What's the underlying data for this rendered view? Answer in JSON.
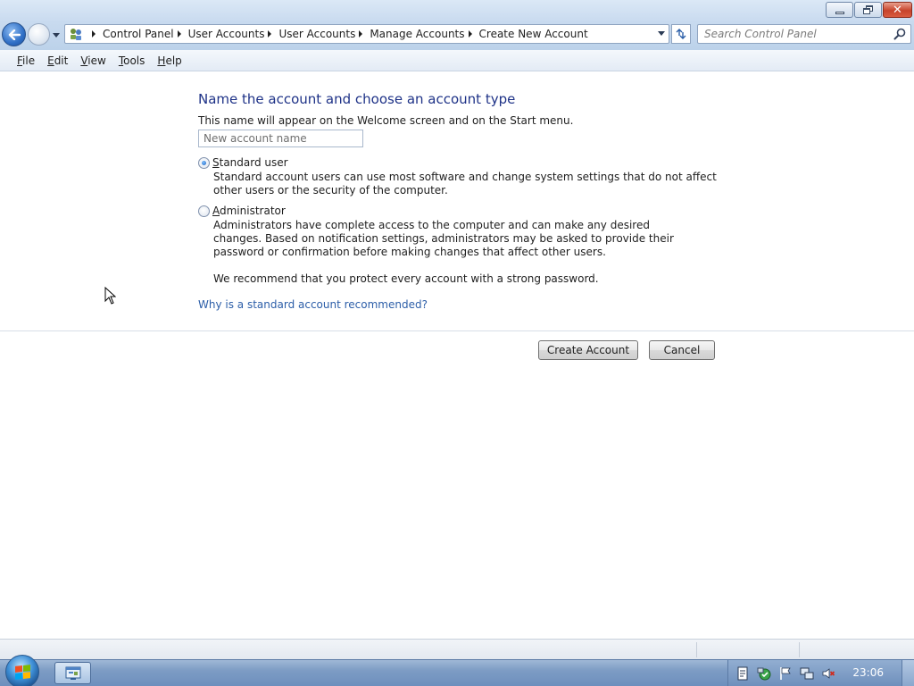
{
  "window": {
    "minimize_icon": "minimize-icon",
    "maximize_icon": "restore-icon",
    "close_icon": "close-icon"
  },
  "navigation": {
    "breadcrumbs": [
      "Control Panel",
      "User Accounts",
      "User Accounts",
      "Manage Accounts",
      "Create New Account"
    ],
    "search_placeholder": "Search Control Panel"
  },
  "menu": {
    "items": [
      {
        "underline": "F",
        "rest": "ile"
      },
      {
        "underline": "E",
        "rest": "dit"
      },
      {
        "underline": "V",
        "rest": "iew"
      },
      {
        "underline": "T",
        "rest": "ools"
      },
      {
        "underline": "H",
        "rest": "elp"
      }
    ]
  },
  "form": {
    "heading": "Name the account and choose an account type",
    "subtext": "This name will appear on the Welcome screen and on the Start menu.",
    "name_placeholder": "New account name",
    "standard_option": {
      "label_underline": "S",
      "label_rest": "tandard user",
      "description": "Standard account users can use most software and change system settings that do not affect other users or the security of the computer.",
      "selected": true
    },
    "admin_option": {
      "label_underline": "A",
      "label_rest": "dministrator",
      "description": "Administrators have complete access to the computer and can make any desired changes. Based on notification settings, administrators may be asked to provide their password or confirmation before making changes that affect other users.",
      "selected": false
    },
    "recommendation": "We recommend that you protect every account with a strong password.",
    "help_link": "Why is a standard account recommended?",
    "create_button": "Create Account",
    "cancel_button": "Cancel"
  },
  "taskbar": {
    "clock": "23:06"
  },
  "colors": {
    "heading": "#1e3287",
    "link": "#2c5ea8",
    "taskbar": "#7d9cc4"
  }
}
